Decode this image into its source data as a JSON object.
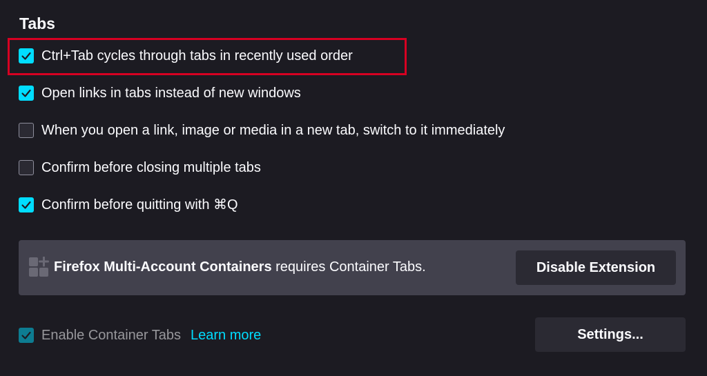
{
  "section": {
    "title": "Tabs"
  },
  "options": [
    {
      "label": "Ctrl+Tab cycles through tabs in recently used order",
      "checked": true
    },
    {
      "label": "Open links in tabs instead of new windows",
      "checked": true
    },
    {
      "label": "When you open a link, image or media in a new tab, switch to it immediately",
      "checked": false
    },
    {
      "label": "Confirm before closing multiple tabs",
      "checked": false
    },
    {
      "label": "Confirm before quitting with ⌘Q",
      "checked": true
    }
  ],
  "notice": {
    "icon": "extension-puzzle-icon",
    "extension_name": "Firefox Multi-Account Containers",
    "message": " requires Container Tabs.",
    "button_label": "Disable Extension"
  },
  "container_tabs": {
    "label": "Enable Container Tabs",
    "checked": true,
    "disabled": true,
    "learn_more_label": "Learn more",
    "settings_label": "Settings..."
  },
  "colors": {
    "background": "#1c1b22",
    "accent": "#00ddff",
    "notice_background": "#42414d",
    "button_background": "#2b2a33",
    "highlight": "#d70022"
  }
}
